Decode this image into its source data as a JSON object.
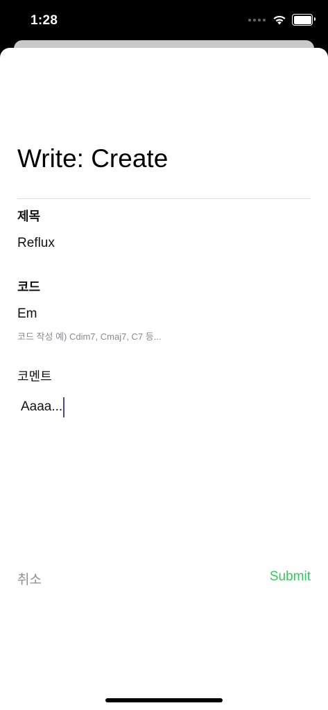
{
  "status_bar": {
    "time": "1:28",
    "icons": [
      "signal-dots-icon",
      "wifi-icon",
      "battery-icon"
    ]
  },
  "form": {
    "title": "Write: Create",
    "title_label": "제목",
    "title_value": "Reflux",
    "code_label": "코드",
    "code_value": "Em",
    "code_hint": "코드 작성 예) Cdim7, Cmaj7, C7 등...",
    "comment_label": "코멘트",
    "comment_value": "Aaaa..."
  },
  "actions": {
    "cancel_label": "취소",
    "submit_label": "Submit"
  },
  "colors": {
    "submit": "#34c759",
    "cancel": "#8e8e93",
    "caret": "#4b3dc4"
  }
}
